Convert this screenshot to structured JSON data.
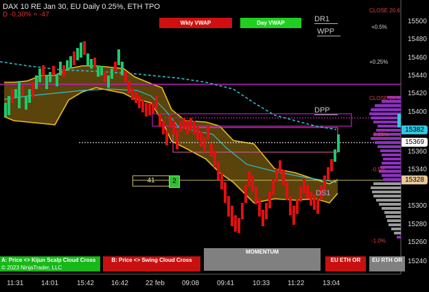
{
  "header": {
    "title": "DAX 10   RE Jan 30, EU Daily 0.25%, ETH TPO",
    "change": "D -0.30% = -47"
  },
  "buttons": {
    "wkly_vwap": "Wkly VWAP",
    "day_vwap": "Day VWAP"
  },
  "levels": {
    "dr1": "DR1",
    "wpp": "WPP",
    "dpp": "DPP",
    "ds1": "DS1"
  },
  "close_labels": {
    "close_top": "CLOSE 20.6",
    "close_mid": "CLOSE 20.6"
  },
  "pct_labels": [
    {
      "text": "+0.5%",
      "color": "#d0d0d0"
    },
    {
      "text": "+0.25%",
      "color": "#d0d0d0"
    },
    {
      "text": "-0.25%",
      "color": "#e04040"
    },
    {
      "text": "-0.5%",
      "color": "#e04040"
    },
    {
      "text": "-1.0%",
      "color": "#e04040"
    }
  ],
  "y_axis": [
    "15500",
    "15480",
    "15460",
    "15440",
    "15420",
    "15400",
    "15380",
    "15360",
    "15340",
    "15320",
    "15300",
    "15280",
    "15260",
    "15240"
  ],
  "price_tags": {
    "vwap": "15382",
    "last": "15369",
    "ds1_price": "15328"
  },
  "x_axis": [
    "11:31",
    "14:01",
    "15:42",
    "16:42",
    "22 feb",
    "09:08",
    "09:41",
    "10:33",
    "11:22",
    "13:04"
  ],
  "counter": {
    "value": "41",
    "badge": "2"
  },
  "bottom": {
    "kijun": "A: Price <> Kijun Scalp Cloud Cross",
    "copyright": "© 2023 NinjaTrader, LLC",
    "swing": "B: Price <> Swing Cloud Cross",
    "momentum": "MOMENTUM",
    "eu_eth": "EU ETH OR",
    "eu_rth": "EU RTH OR"
  },
  "colors": {
    "up": "#1ec86e",
    "down": "#e01010",
    "cloud": "#7a5a10",
    "cloud_edge": "#e8c020",
    "vwap_line": "#30c0d0",
    "magenta": "#c020c0",
    "profile": "#9030c0",
    "wkly_btn": "#d01010",
    "day_btn": "#20d020"
  }
}
